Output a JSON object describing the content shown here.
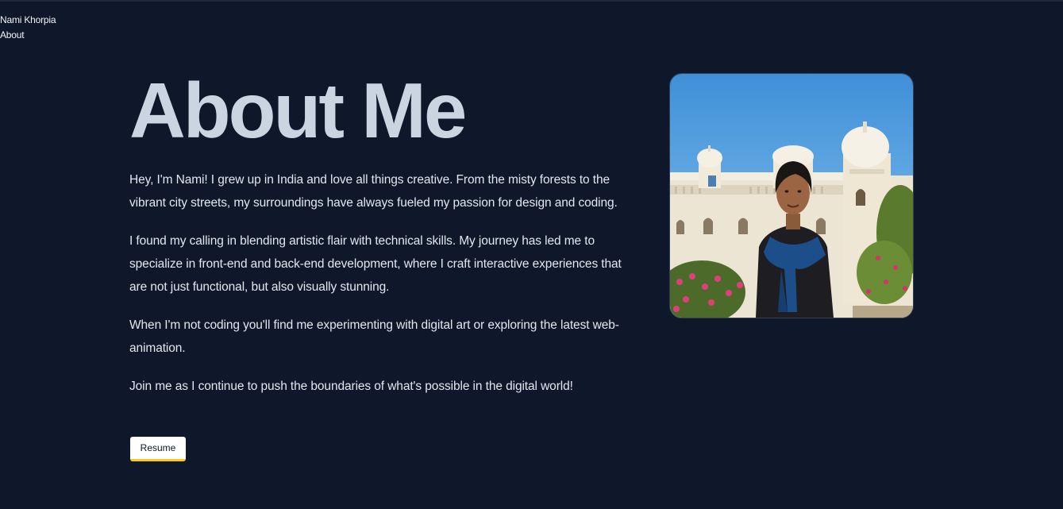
{
  "nav": {
    "name": "Nami Khorpia",
    "about": "About"
  },
  "main": {
    "title": "About Me",
    "paragraphs": [
      "Hey, I'm Nami! I grew up in India and love all things creative. From the misty forests to the vibrant city streets, my surroundings have always fueled my passion for design and coding.",
      "I found my calling in blending artistic flair with technical skills. My journey has led me to specialize in front-end and back-end development, where I craft interactive experiences that are not just functional, but also visually stunning.",
      "When I'm not coding you'll find me experimenting with digital art or exploring the latest web-animation.",
      "Join me as I continue to push the boundaries of what's possible in the digital world!"
    ],
    "resume_label": "Resume"
  },
  "colors": {
    "background": "#0f172a",
    "title": "#cbd5e1",
    "button_accent": "#facc15"
  }
}
